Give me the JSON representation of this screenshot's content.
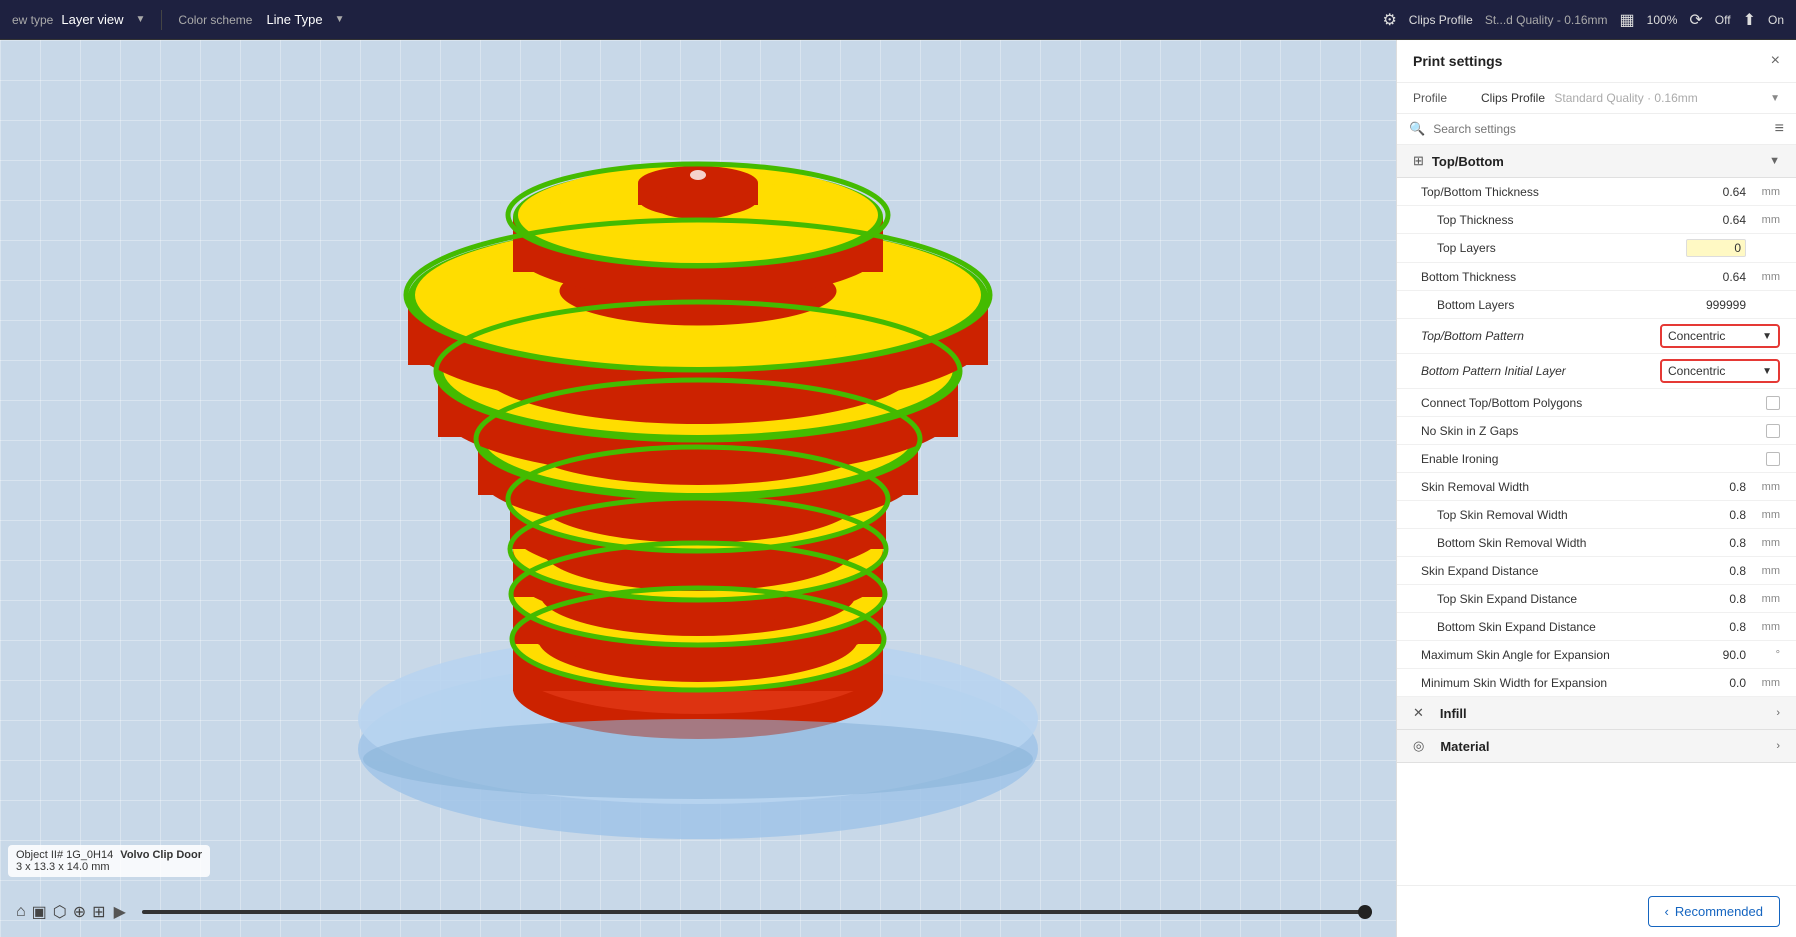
{
  "topbar": {
    "view_type_label": "ew type",
    "view_type_value": "Layer view",
    "color_scheme_label": "Color scheme",
    "color_scheme_value": "Line Type",
    "profile_name": "Clips Profile",
    "profile_quality": "St...d Quality - 0.16mm",
    "zoom_level": "100%",
    "sync_label": "Off",
    "upload_icon": "⬆",
    "on_label": "On"
  },
  "viewport": {
    "object_label": "Object II#",
    "object_id": "1G_0H14",
    "object_name": "Volvo Clip Door",
    "object_dims": "3 x 13.3 x 14.0 mm"
  },
  "panel": {
    "title": "Print settings",
    "close_label": "×",
    "profile_label": "Profile",
    "profile_value": "Clips Profile",
    "profile_quality": "Standard Quality · 0.16mm",
    "search_placeholder": "Search settings"
  },
  "sections": {
    "top_bottom": {
      "title": "Top/Bottom",
      "icon": "⊞",
      "expanded": true,
      "settings": [
        {
          "name": "Top/Bottom Thickness",
          "value": "0.64",
          "unit": "mm",
          "highlighted": false,
          "type": "value"
        },
        {
          "name": "Top Thickness",
          "value": "0.64",
          "unit": "mm",
          "highlighted": false,
          "type": "value",
          "indent": true
        },
        {
          "name": "Top Layers",
          "value": "0",
          "unit": "",
          "highlighted": true,
          "type": "value",
          "indent": true
        },
        {
          "name": "Bottom Thickness",
          "value": "0.64",
          "unit": "mm",
          "highlighted": false,
          "type": "value"
        },
        {
          "name": "Bottom Layers",
          "value": "999999",
          "unit": "",
          "highlighted": false,
          "type": "value",
          "indent": true
        },
        {
          "name": "Top/Bottom Pattern",
          "value": "Concentric",
          "unit": "",
          "highlighted": false,
          "type": "dropdown",
          "annotated": true
        },
        {
          "name": "Bottom Pattern Initial Layer",
          "value": "Concentric",
          "unit": "",
          "highlighted": false,
          "type": "dropdown",
          "annotated": true
        },
        {
          "name": "Connect Top/Bottom Polygons",
          "value": "",
          "unit": "",
          "highlighted": false,
          "type": "checkbox"
        },
        {
          "name": "No Skin in Z Gaps",
          "value": "",
          "unit": "",
          "highlighted": false,
          "type": "checkbox"
        },
        {
          "name": "Enable Ironing",
          "value": "",
          "unit": "",
          "highlighted": false,
          "type": "checkbox"
        },
        {
          "name": "Skin Removal Width",
          "value": "0.8",
          "unit": "mm",
          "highlighted": false,
          "type": "value"
        },
        {
          "name": "Top Skin Removal Width",
          "value": "0.8",
          "unit": "mm",
          "highlighted": false,
          "type": "value",
          "indent": true
        },
        {
          "name": "Bottom Skin Removal Width",
          "value": "0.8",
          "unit": "mm",
          "highlighted": false,
          "type": "value",
          "indent": true
        },
        {
          "name": "Skin Expand Distance",
          "value": "0.8",
          "unit": "mm",
          "highlighted": false,
          "type": "value"
        },
        {
          "name": "Top Skin Expand Distance",
          "value": "0.8",
          "unit": "mm",
          "highlighted": false,
          "type": "value",
          "indent": true
        },
        {
          "name": "Bottom Skin Expand Distance",
          "value": "0.8",
          "unit": "mm",
          "highlighted": false,
          "type": "value",
          "indent": true
        },
        {
          "name": "Maximum Skin Angle for Expansion",
          "value": "90.0",
          "unit": "°",
          "highlighted": false,
          "type": "value"
        },
        {
          "name": "Minimum Skin Width for Expansion",
          "value": "0.0",
          "unit": "mm",
          "highlighted": false,
          "type": "value"
        }
      ]
    },
    "infill": {
      "title": "Infill",
      "icon": "✕",
      "expanded": false
    },
    "material": {
      "title": "Material",
      "icon": "◎",
      "expanded": false
    }
  },
  "footer": {
    "recommended_label": "Recommended",
    "chevron_left": "‹"
  }
}
